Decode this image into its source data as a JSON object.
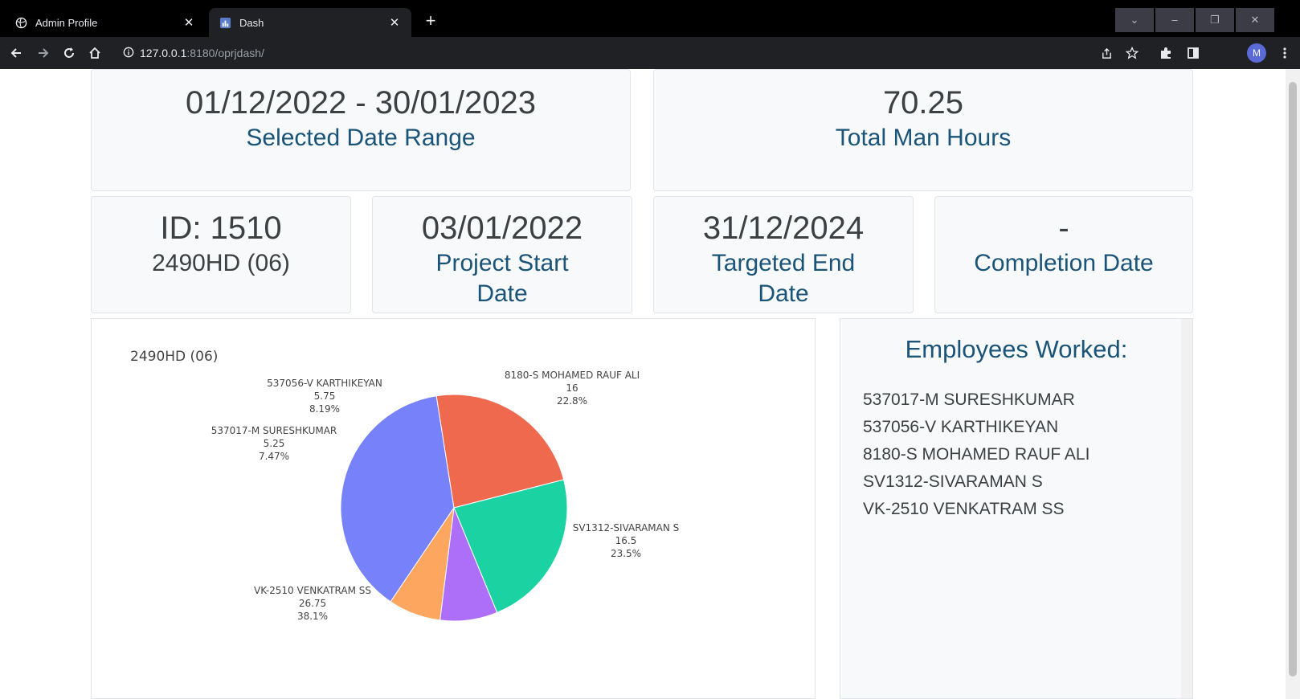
{
  "browser": {
    "tabs": [
      {
        "label": "Admin Profile",
        "active": false
      },
      {
        "label": "Dash",
        "active": true
      }
    ],
    "url_host": "127.0.0.1",
    "url_rest": ":8180/oprjdash/",
    "profile_initial": "M"
  },
  "cards": {
    "date_range": {
      "value": "01/12/2022 - 30/01/2023",
      "label": "Selected Date Range"
    },
    "man_hours": {
      "value": "70.25",
      "label": "Total Man Hours"
    },
    "project": {
      "id": "ID: 1510",
      "code": "2490HD (06)"
    },
    "start": {
      "value": "03/01/2022",
      "label": "Project Start Date"
    },
    "end": {
      "value": "31/12/2024",
      "label": "Targeted End Date"
    },
    "completion": {
      "value": "-",
      "label": "Completion Date"
    }
  },
  "employees": {
    "title": "Employees Worked:",
    "list": [
      "537017-M SURESHKUMAR",
      "537056-V KARTHIKEYAN",
      "8180-S MOHAMED RAUF ALI",
      "SV1312-SIVARAMAN S",
      "VK-2510 VENKATRAM SS"
    ]
  },
  "chart_data": {
    "type": "pie",
    "title": "2490HD (06)",
    "slices": [
      {
        "name": "VK-2510 VENKATRAM SS",
        "value": 26.75,
        "percent": "38.1%",
        "color": "#7681fa"
      },
      {
        "name": "SV1312-SIVARAMAN S",
        "value": 16.5,
        "percent": "23.5%",
        "color": "#ef694f"
      },
      {
        "name": "8180-S MOHAMED RAUF ALI",
        "value": 16,
        "percent": "22.8%",
        "color": "#1bd3a2"
      },
      {
        "name": "537056-V KARTHIKEYAN",
        "value": 5.75,
        "percent": "8.19%",
        "color": "#ae6ff8"
      },
      {
        "name": "537017-M SURESHKUMAR",
        "value": 5.25,
        "percent": "7.47%",
        "color": "#fda65f"
      }
    ]
  }
}
